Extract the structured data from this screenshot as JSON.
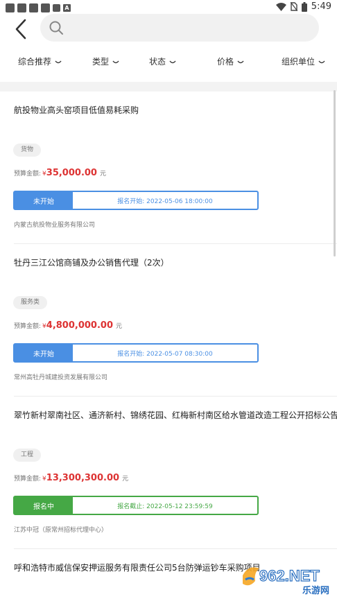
{
  "status_bar": {
    "time": "5:49",
    "notif_letter": "A"
  },
  "search": {
    "placeholder": ""
  },
  "filters": [
    "综合推荐",
    "类型",
    "状态",
    "价格",
    "组织单位"
  ],
  "items": [
    {
      "title": "航投物业高头窑项目低值易耗采购",
      "tag": "货物",
      "budget_label": "预算金额:",
      "currency": "¥",
      "budget": "35,000.00",
      "unit": "元",
      "status": "未开始",
      "time_text": "报名开始: 2022-05-06 18:00:00",
      "org": "内蒙古航投物业服务有限公司",
      "state": "blue"
    },
    {
      "title": "牡丹三江公馆商铺及办公销售代理（2次）",
      "tag": "服务类",
      "budget_label": "预算金额:",
      "currency": "¥",
      "budget": "4,800,000.00",
      "unit": "元",
      "status": "未开始",
      "time_text": "报名开始: 2022-05-07 08:30:00",
      "org": "常州高牡丹城建投资发展有限公司",
      "state": "blue"
    },
    {
      "title": "翠竹新村翠南社区、通济新村、锦绣花园、红梅新村南区给水管道改造工程公开招标公告",
      "tag": "工程",
      "budget_label": "预算金额:",
      "currency": "¥",
      "budget": "13,300,300.00",
      "unit": "元",
      "status": "报名中",
      "time_text": "报名截止: 2022-05-12 23:59:59",
      "org": "江苏中冠（原常州招标代理中心）",
      "state": "green"
    },
    {
      "title": "呼和浩特市威信保安押运服务有限责任公司5台防弹运钞车采购项目",
      "state": "partial"
    }
  ],
  "watermark": {
    "brand": "962.NET",
    "sub": "乐游网"
  },
  "colors": {
    "blue": "#4a8fe3",
    "green": "#45a845",
    "price": "#d33333"
  }
}
